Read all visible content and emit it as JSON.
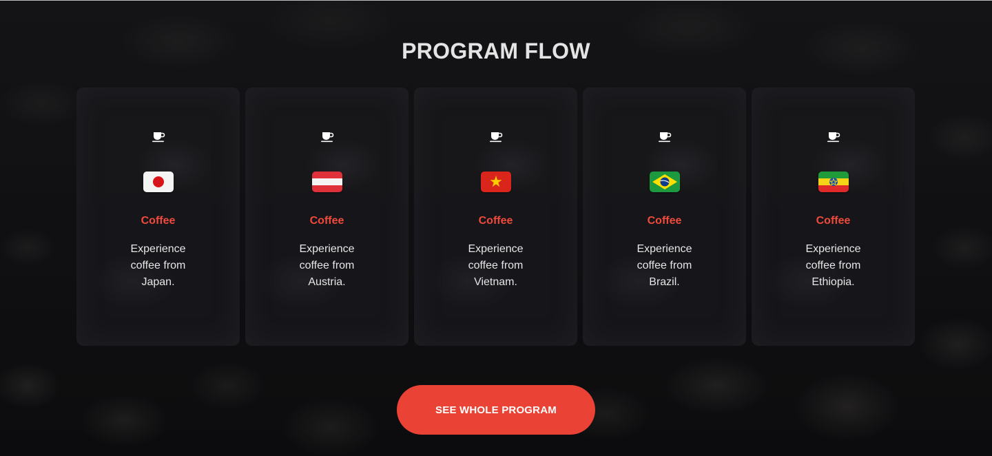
{
  "section": {
    "title": "PROGRAM FLOW"
  },
  "cards": [
    {
      "icon": "coffee-cup-icon",
      "flag": "japan-flag-icon",
      "title": "Coffee",
      "description": "Experience coffee from Japan."
    },
    {
      "icon": "coffee-cup-icon",
      "flag": "austria-flag-icon",
      "title": "Coffee",
      "description": "Experience coffee from Austria."
    },
    {
      "icon": "coffee-cup-icon",
      "flag": "vietnam-flag-icon",
      "title": "Coffee",
      "description": "Experience coffee from Vietnam."
    },
    {
      "icon": "coffee-cup-icon",
      "flag": "brazil-flag-icon",
      "title": "Coffee",
      "description": "Experience coffee from Brazil."
    },
    {
      "icon": "coffee-cup-icon",
      "flag": "ethiopia-flag-icon",
      "title": "Coffee",
      "description": "Experience coffee from Ethiopia."
    }
  ],
  "cta": {
    "label": "SEE WHOLE PROGRAM"
  },
  "colors": {
    "accent": "#ea4335",
    "card_title": "#ef4a3b",
    "heading": "#e4e4e4"
  }
}
